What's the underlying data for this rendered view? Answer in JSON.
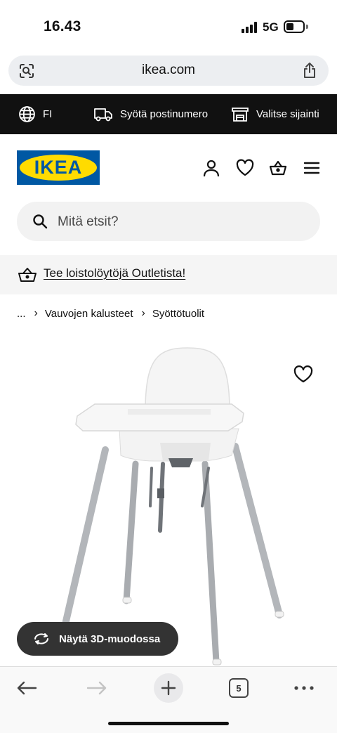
{
  "status_bar": {
    "time": "16.43",
    "network": "5G",
    "battery_level": 0.45
  },
  "browser": {
    "url": "ikea.com"
  },
  "info_bar": {
    "language": "FI",
    "postcode": "Syötä postinumero",
    "location": "Valitse sijainti"
  },
  "header": {
    "logo_text": "IKEA"
  },
  "search": {
    "placeholder": "Mitä etsit?"
  },
  "promo": {
    "text": "Tee loistolöytöjä Outletista!"
  },
  "breadcrumb": {
    "items": [
      "...",
      "Vauvojen kalusteet",
      "Syöttötuolit"
    ]
  },
  "product": {
    "view_3d_label": "Näytä 3D-muodossa"
  },
  "toolbar": {
    "tab_count": "5"
  },
  "colors": {
    "ikea_blue": "#0058a3",
    "ikea_yellow": "#ffdb00",
    "info_bar_bg": "#111111",
    "button_3d_bg": "#333333"
  }
}
